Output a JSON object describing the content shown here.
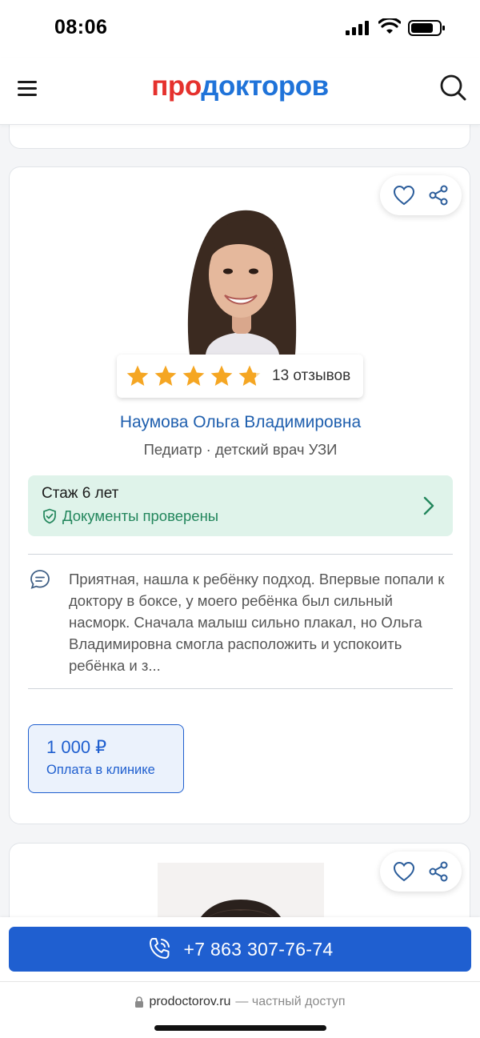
{
  "status_bar": {
    "time": "08:06"
  },
  "header": {
    "logo_part1": "про",
    "logo_part2": "докторов"
  },
  "doctor": {
    "name": "Наумова Ольга Владимировна",
    "specialties": "Педиатр · детский врач УЗИ",
    "rating_stars": 4.8,
    "reviews_count": "13 отзывов",
    "experience": "Стаж 6 лет",
    "verified": "Документы проверены",
    "review_excerpt": "Приятная, нашла к ребёнку подход. Впервые попали к доктору в боксе, у моего ребёнка был сильный насморк. Сначала малыш сильно плакал, но Ольга Владимировна смогла расположить и успокоить ребёнка и з...",
    "price": "1 000 ₽",
    "price_note": "Оплата в клинике"
  },
  "bottom": {
    "phone": "+7 863 307-76-74",
    "url_domain": "prodoctorov.ru",
    "url_note": "— частный доступ"
  },
  "colors": {
    "brand_red": "#e5312d",
    "brand_blue": "#1f73d9",
    "call_button": "#1f5fd0",
    "star": "#f5a623",
    "verified_green": "#22865c"
  }
}
